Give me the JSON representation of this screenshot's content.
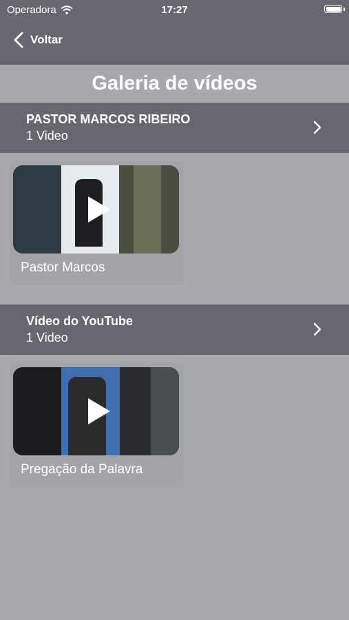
{
  "status_bar": {
    "carrier": "Operadora",
    "time": "17:27"
  },
  "nav": {
    "back_label": "Voltar"
  },
  "page": {
    "title": "Galeria de vídeos"
  },
  "sections": [
    {
      "title": "PASTOR MARCOS RIBEIRO",
      "count": "1 Video",
      "videos": [
        {
          "title": "Pastor Marcos"
        }
      ]
    },
    {
      "title": "Vídeo do YouTube",
      "count": "1 Video",
      "videos": [
        {
          "title": "Pregação da Palavra"
        }
      ]
    }
  ],
  "colors": {
    "bar": "#66676f",
    "background": "#a8a9ad",
    "text": "#ffffff"
  },
  "icons": {
    "back": "chevron-left-icon",
    "disclosure": "chevron-right-icon",
    "wifi": "wifi-icon",
    "battery": "battery-icon",
    "play": "play-icon"
  }
}
